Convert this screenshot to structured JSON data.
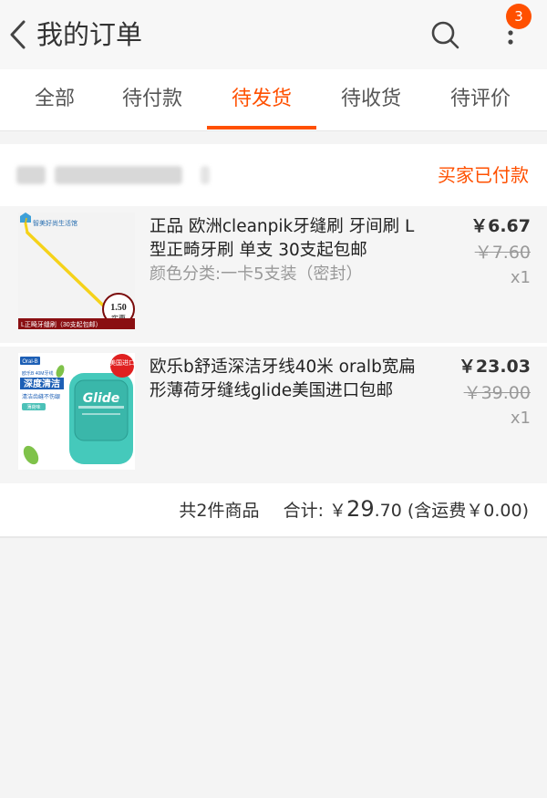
{
  "header": {
    "title": "我的订单",
    "badge_count": "3"
  },
  "tabs": [
    {
      "label": "全部",
      "active": false
    },
    {
      "label": "待付款",
      "active": false
    },
    {
      "label": "待发货",
      "active": true
    },
    {
      "label": "待收货",
      "active": false
    },
    {
      "label": "待评价",
      "active": false
    }
  ],
  "order": {
    "status": "买家已付款",
    "items": [
      {
        "title": "正品 欧洲cleanpik牙缝刷 牙间刷 L型正畸牙刷 单支 30支起包邮",
        "spec": "颜色分类:一卡5支装（密封）",
        "price": "￥6.67",
        "original_price": "￥7.60",
        "quantity": "x1",
        "thumb": {
          "shop_label": "智美好尚生活馆",
          "price_tag": "1.50",
          "price_tag_sub": "实惠",
          "caption": "L正畸牙缝刷（30支起包邮）"
        }
      },
      {
        "title": "欧乐b舒适深洁牙线40米 oralb宽扁形薄荷牙缝线glide美国进口包邮",
        "spec": "",
        "price": "￥23.03",
        "original_price": "￥39.00",
        "quantity": "x1",
        "thumb": {
          "brand": "Oral-B",
          "badge": "美国进口",
          "small_text": "欧乐B 40M牙线",
          "headline": "深度清洁",
          "sub": "清洁齿缝不伤龈",
          "flavor": "薄荷味",
          "product_name": "Glide"
        }
      }
    ],
    "summary": {
      "count_text": "共2件商品",
      "total_label": "合计: ￥",
      "total_int": "29",
      "total_dec": ".70",
      "shipping_text": "(含运费￥0.00)"
    }
  },
  "colors": {
    "accent": "#ff5000",
    "header_bg": "#f7f7f7",
    "item_bg": "#f5f5f5"
  }
}
